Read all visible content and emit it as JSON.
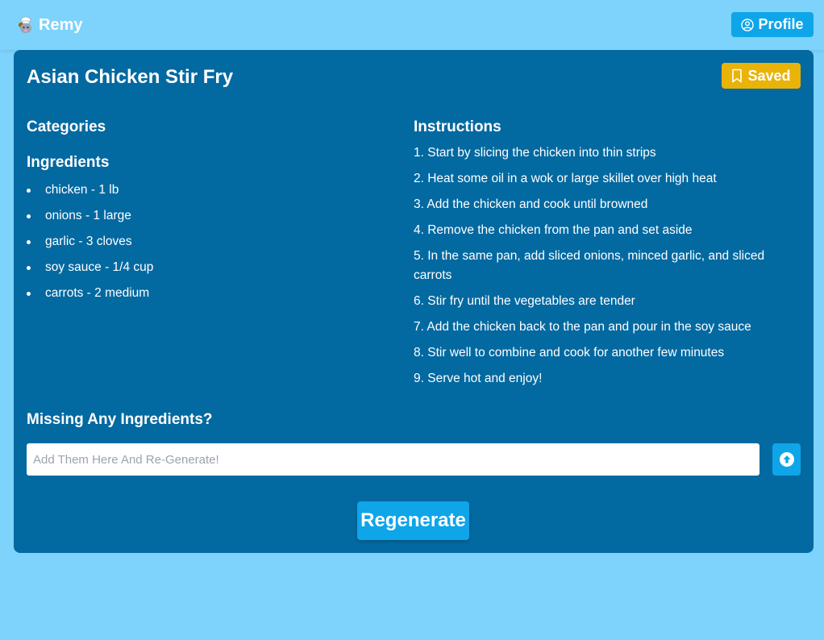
{
  "app": {
    "brand": "Remy",
    "brand_icon": "chef-mouse-icon",
    "profile_label": "Profile",
    "profile_icon": "user-circle-icon"
  },
  "colors": {
    "background": "#7dd3fc",
    "card": "#0369a1",
    "accent": "#0ea5e9",
    "saved": "#eab308"
  },
  "recipe": {
    "title": "Asian Chicken Stir Fry",
    "saved_label": "Saved",
    "saved_icon": "bookmark-icon",
    "categories_heading": "Categories",
    "ingredients_heading": "Ingredients",
    "ingredients": [
      "chicken - 1 lb",
      "onions - 1 large",
      "garlic - 3 cloves",
      "soy sauce - 1/4 cup",
      "carrots - 2 medium"
    ],
    "instructions_heading": "Instructions",
    "instructions": [
      "1. Start by slicing the chicken into thin strips",
      "2. Heat some oil in a wok or large skillet over high heat",
      "3. Add the chicken and cook until browned",
      "4. Remove the chicken from the pan and set aside",
      "5. In the same pan, add sliced onions, minced garlic, and sliced carrots",
      "6. Stir fry until the vegetables are tender",
      "7. Add the chicken back to the pan and pour in the soy sauce",
      "8. Stir well to combine and cook for another few minutes",
      "9. Serve hot and enjoy!"
    ]
  },
  "missing": {
    "heading": "Missing Any Ingredients?",
    "placeholder": "Add Them Here And Re-Generate!",
    "value": "",
    "upload_icon": "arrow-up-circle-icon"
  },
  "regenerate_label": "Regenerate"
}
